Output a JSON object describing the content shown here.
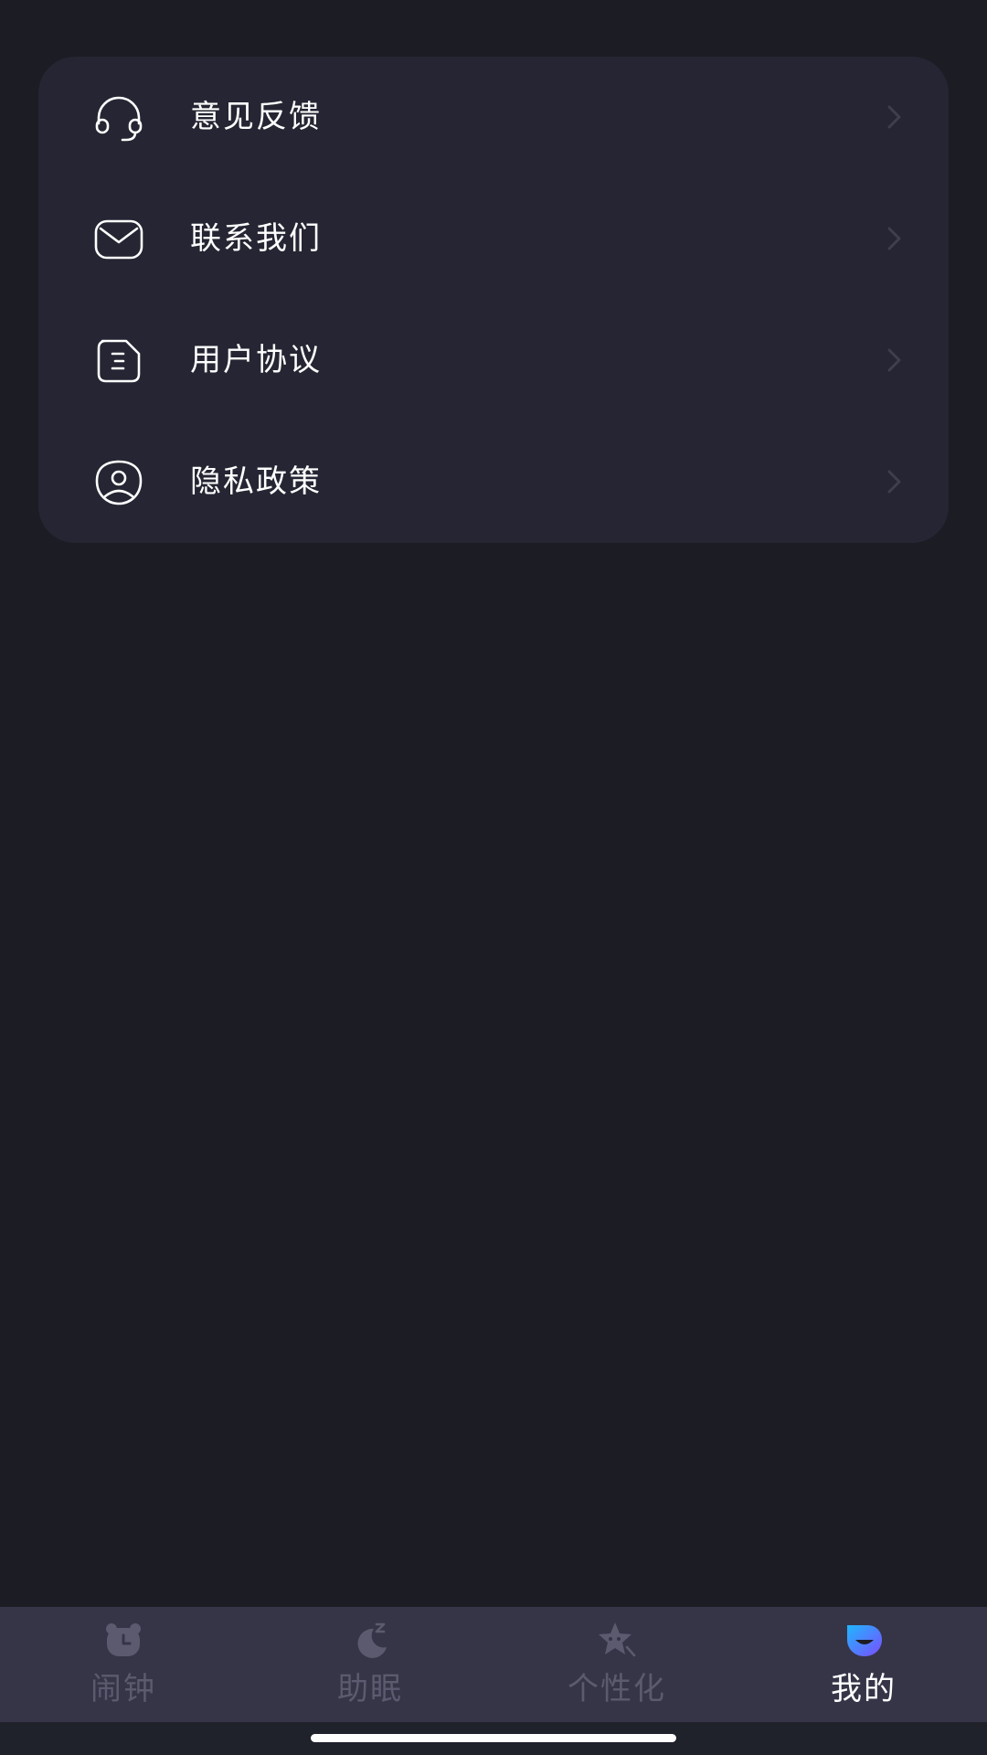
{
  "menu": {
    "items": [
      {
        "label": "意见反馈",
        "icon": "headset-icon"
      },
      {
        "label": "联系我们",
        "icon": "mail-icon"
      },
      {
        "label": "用户协议",
        "icon": "document-icon"
      },
      {
        "label": "隐私政策",
        "icon": "user-shield-icon"
      }
    ]
  },
  "tabbar": {
    "tabs": [
      {
        "label": "闹钟",
        "icon": "alarm-bear-icon",
        "active": false
      },
      {
        "label": "助眠",
        "icon": "moon-sleep-icon",
        "active": false
      },
      {
        "label": "个性化",
        "icon": "star-face-icon",
        "active": false
      },
      {
        "label": "我的",
        "icon": "profile-smile-icon",
        "active": true
      }
    ]
  },
  "colors": {
    "background": "#1c1c24",
    "card": "#252533",
    "tabbar": "#363548",
    "inactive_tab": "#5b5a6e",
    "active_gradient_start": "#1fb6ff",
    "active_gradient_end": "#7b4dff"
  }
}
